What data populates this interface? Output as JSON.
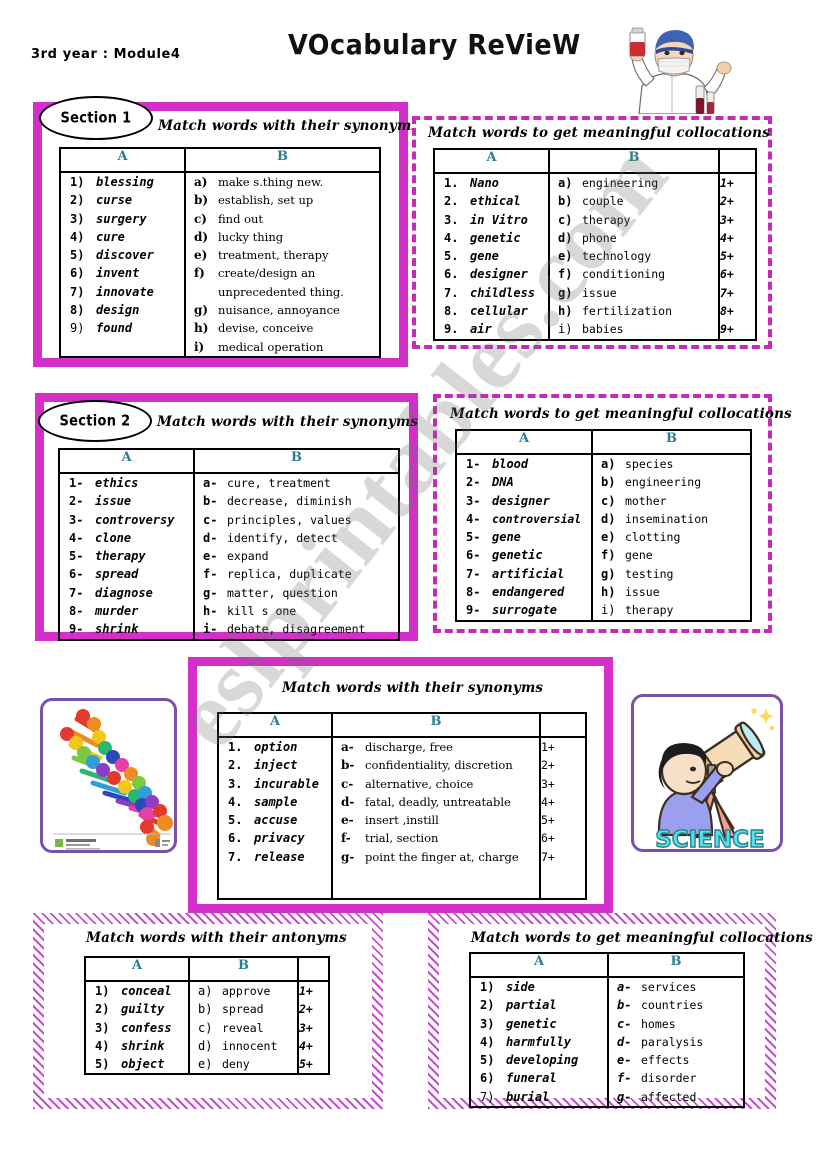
{
  "header": {
    "course": "3rd  year  : Module4",
    "title": "VOcabulary ReVieW",
    "scientist_alt": "scientist-holding-flask"
  },
  "watermark": {
    "text": "eslprintables.com"
  },
  "sections": {
    "s1_label": "Section 1",
    "s2_label": "Section 2"
  },
  "instructions": {
    "synonyms": "Match words with their synonyms",
    "collocations": "Match words to get meaningful collocations",
    "antonyms": "Match words with their antonyms"
  },
  "columns": {
    "a": "A",
    "b": "B"
  },
  "tables": {
    "t1": {
      "title": "Match words with their synonyms",
      "colA": [
        {
          "mk": "1)",
          "tx": "blessing"
        },
        {
          "mk": "2)",
          "tx": "curse"
        },
        {
          "mk": "3)",
          "tx": "surgery"
        },
        {
          "mk": "4)",
          "tx": "cure"
        },
        {
          "mk": "5)",
          "tx": "discover"
        },
        {
          "mk": "6)",
          "tx": "invent"
        },
        {
          "mk": "7)",
          "tx": "innovate"
        },
        {
          "mk": "8)",
          "tx": "design"
        },
        {
          "mk": "9)",
          "tx": "found"
        }
      ],
      "colB": [
        {
          "mk": "a)",
          "tx": "make  s.thing new."
        },
        {
          "mk": "b)",
          "tx": "establish, set up"
        },
        {
          "mk": "c)",
          "tx": "find out"
        },
        {
          "mk": "d)",
          "tx": "lucky thing"
        },
        {
          "mk": "e)",
          "tx": "treatment, therapy"
        },
        {
          "mk": "f)",
          "tx": "create/design an"
        },
        {
          "mk": "",
          "tx": "unprecedented thing."
        },
        {
          "mk": "g)",
          "tx": "nuisance, annoyance"
        },
        {
          "mk": "h)",
          "tx": "devise, conceive"
        },
        {
          "mk": "i)",
          "tx": "medical operation"
        }
      ]
    },
    "t2": {
      "title": "Match words to get meaningful collocations",
      "colA": [
        {
          "mk": "1.",
          "tx": "Nano"
        },
        {
          "mk": "2.",
          "tx": "ethical"
        },
        {
          "mk": "3.",
          "tx": "in Vitro"
        },
        {
          "mk": "4.",
          "tx": "genetic"
        },
        {
          "mk": "5.",
          "tx": "gene"
        },
        {
          "mk": "6.",
          "tx": "designer"
        },
        {
          "mk": "7.",
          "tx": "childless"
        },
        {
          "mk": "8.",
          "tx": "cellular"
        },
        {
          "mk": "9.",
          "tx": "air"
        }
      ],
      "colB": [
        {
          "mk": "a)",
          "tx": "engineering"
        },
        {
          "mk": "b)",
          "tx": "couple"
        },
        {
          "mk": "c)",
          "tx": "therapy"
        },
        {
          "mk": "d)",
          "tx": "phone"
        },
        {
          "mk": "e)",
          "tx": "technology"
        },
        {
          "mk": "f)",
          "tx": "conditioning"
        },
        {
          "mk": "g)",
          "tx": "issue"
        },
        {
          "mk": "h)",
          "tx": "fertilization"
        },
        {
          "mk": "i)",
          "tx": "babies"
        }
      ],
      "colC": [
        "1+",
        "2+",
        "3+",
        "4+",
        "5+",
        "6+",
        "7+",
        "8+",
        "9+"
      ]
    },
    "t3": {
      "title": "Match words with their synonyms",
      "colA": [
        {
          "mk": "1-",
          "tx": "ethics"
        },
        {
          "mk": "2-",
          "tx": "issue"
        },
        {
          "mk": "3-",
          "tx": "controversy"
        },
        {
          "mk": "4-",
          "tx": "clone"
        },
        {
          "mk": "5-",
          "tx": "therapy"
        },
        {
          "mk": "6-",
          "tx": "spread"
        },
        {
          "mk": "7-",
          "tx": "diagnose"
        },
        {
          "mk": "8-",
          "tx": "murder"
        },
        {
          "mk": "9-",
          "tx": "shrink"
        }
      ],
      "colB": [
        {
          "mk": "a-",
          "tx": "cure, treatment"
        },
        {
          "mk": "b-",
          "tx": "decrease, diminish"
        },
        {
          "mk": "c-",
          "tx": "principles, values"
        },
        {
          "mk": "d-",
          "tx": "identify, detect"
        },
        {
          "mk": "e-",
          "tx": "expand"
        },
        {
          "mk": "f-",
          "tx": "replica, duplicate"
        },
        {
          "mk": "g-",
          "tx": "matter, question"
        },
        {
          "mk": "h-",
          "tx": "kill s one"
        },
        {
          "mk": "i-",
          "tx": "debate, disagreement"
        }
      ]
    },
    "t4": {
      "title": "Match words to get meaningful collocations",
      "colA": [
        {
          "mk": "1-",
          "tx": "blood"
        },
        {
          "mk": "2-",
          "tx": "DNA"
        },
        {
          "mk": "3-",
          "tx": "designer"
        },
        {
          "mk": "4-",
          "tx": "controversial"
        },
        {
          "mk": "5-",
          "tx": "gene"
        },
        {
          "mk": "6-",
          "tx": "genetic"
        },
        {
          "mk": "7-",
          "tx": "artificial"
        },
        {
          "mk": "8-",
          "tx": "endangered"
        },
        {
          "mk": "9-",
          "tx": "surrogate"
        }
      ],
      "colB": [
        {
          "mk": "a)",
          "tx": "species"
        },
        {
          "mk": "b)",
          "tx": "engineering"
        },
        {
          "mk": "c)",
          "tx": "mother"
        },
        {
          "mk": "d)",
          "tx": "insemination"
        },
        {
          "mk": "e)",
          "tx": "clotting"
        },
        {
          "mk": "f)",
          "tx": "gene"
        },
        {
          "mk": "g)",
          "tx": "testing"
        },
        {
          "mk": "h)",
          "tx": "issue"
        },
        {
          "mk": "i)",
          "tx": "therapy"
        }
      ]
    },
    "t5": {
      "title": "Match words with their synonyms",
      "colA": [
        {
          "mk": "1.",
          "tx": "option"
        },
        {
          "mk": "2.",
          "tx": "inject"
        },
        {
          "mk": "3.",
          "tx": "incurable"
        },
        {
          "mk": "4.",
          "tx": "sample"
        },
        {
          "mk": "5.",
          "tx": "accuse"
        },
        {
          "mk": "6.",
          "tx": "privacy"
        },
        {
          "mk": "7.",
          "tx": "release"
        }
      ],
      "colB": [
        {
          "mk": "a-",
          "tx": "discharge, free"
        },
        {
          "mk": "b-",
          "tx": "confidentiality, discretion"
        },
        {
          "mk": "c-",
          "tx": "alternative, choice"
        },
        {
          "mk": "d-",
          "tx": "fatal, deadly, untreatable"
        },
        {
          "mk": "e-",
          "tx": "insert ,instill"
        },
        {
          "mk": "f-",
          "tx": "trial, section"
        },
        {
          "mk": "g-",
          "tx": "point the finger at, charge"
        }
      ],
      "colC": [
        "1+",
        "2+",
        "3+",
        "4+",
        "5+",
        "6+",
        "7+"
      ]
    },
    "t6": {
      "title": "Match words with their antonyms",
      "colA": [
        {
          "mk": "1)",
          "tx": "conceal"
        },
        {
          "mk": "2)",
          "tx": "guilty"
        },
        {
          "mk": "3)",
          "tx": "confess"
        },
        {
          "mk": "4)",
          "tx": "shrink"
        },
        {
          "mk": "5)",
          "tx": "object"
        }
      ],
      "colB": [
        {
          "mk": "a)",
          "tx": "approve"
        },
        {
          "mk": "b)",
          "tx": "spread"
        },
        {
          "mk": "c)",
          "tx": "reveal"
        },
        {
          "mk": "d)",
          "tx": "innocent"
        },
        {
          "mk": "e)",
          "tx": "deny"
        }
      ],
      "colC": [
        "1+",
        "2+",
        "3+",
        "4+",
        "5+"
      ]
    },
    "t7": {
      "title": "Match words to get meaningful collocations",
      "colA": [
        {
          "mk": "1)",
          "tx": "side"
        },
        {
          "mk": "2)",
          "tx": "partial"
        },
        {
          "mk": "3)",
          "tx": "genetic"
        },
        {
          "mk": "4)",
          "tx": "harmfully"
        },
        {
          "mk": "5)",
          "tx": "developing"
        },
        {
          "mk": "6)",
          "tx": "funeral"
        },
        {
          "mk": "7)",
          "tx": "burial"
        }
      ],
      "colB": [
        {
          "mk": "a-",
          "tx": "services"
        },
        {
          "mk": "b-",
          "tx": "countries"
        },
        {
          "mk": "c-",
          "tx": "homes"
        },
        {
          "mk": "d-",
          "tx": "paralysis"
        },
        {
          "mk": "e-",
          "tx": "effects"
        },
        {
          "mk": "f-",
          "tx": "disorder"
        },
        {
          "mk": "g-",
          "tx": "affected"
        }
      ]
    }
  },
  "clipart": {
    "dna_alt": "dna-double-helix",
    "science_label": "SCIENCE",
    "science_alt": "boy-with-telescope"
  },
  "colors": {
    "magenta": "#d42fc8",
    "header_teal": "#2b7e92",
    "card_border": "#7a52a8",
    "science_text": "#55e0ee"
  }
}
